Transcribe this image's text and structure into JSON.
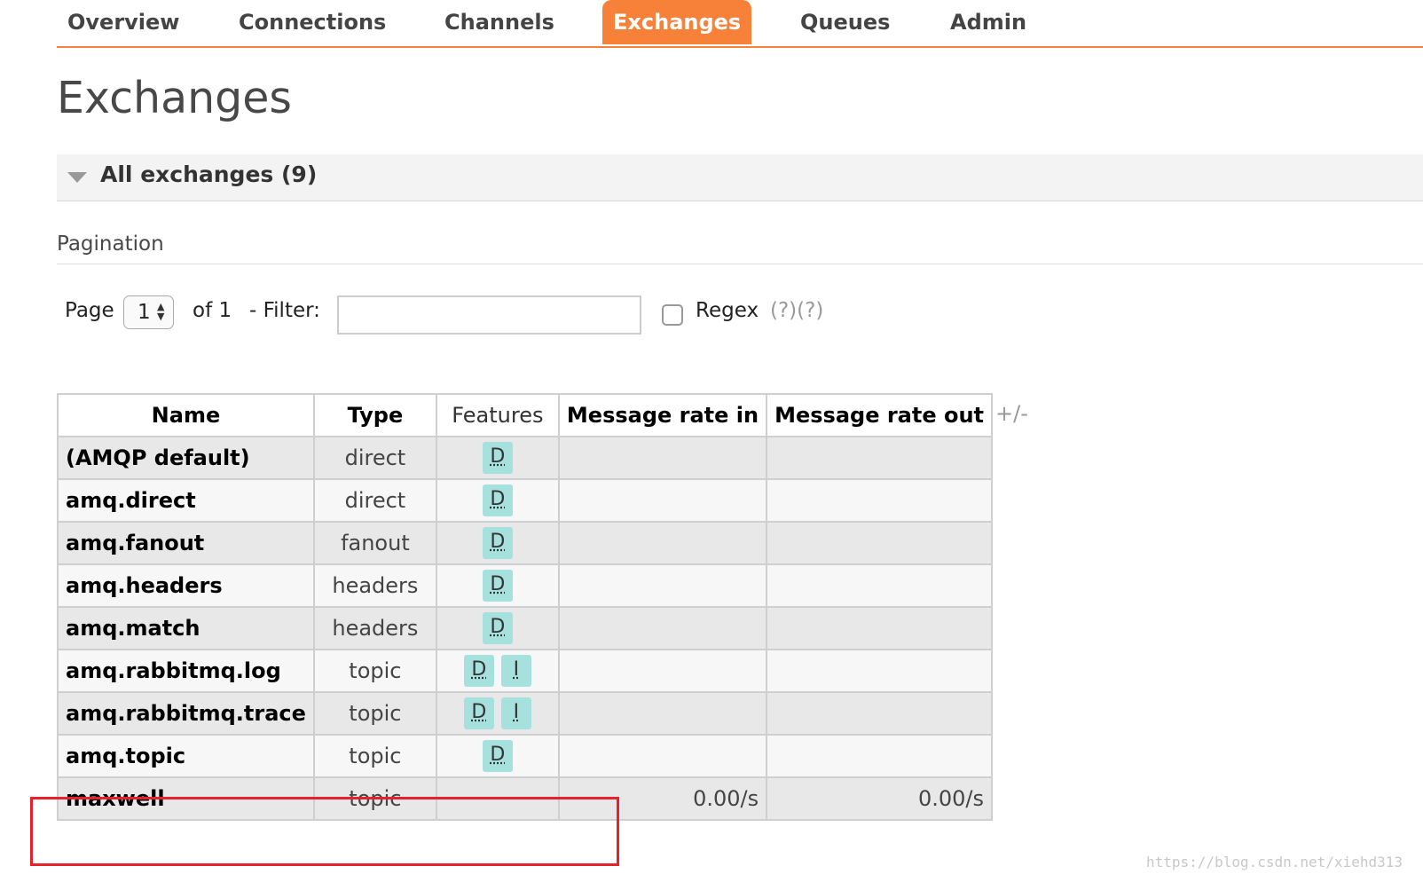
{
  "nav": {
    "tabs": [
      {
        "label": "Overview"
      },
      {
        "label": "Connections"
      },
      {
        "label": "Channels"
      },
      {
        "label": "Exchanges",
        "active": true
      },
      {
        "label": "Queues"
      },
      {
        "label": "Admin"
      }
    ],
    "accent": "#f8813a"
  },
  "page_title": "Exchanges",
  "section": {
    "title": "All exchanges (9)"
  },
  "pagination": {
    "label": "Pagination",
    "page_label": "Page",
    "page_value": "1",
    "of_label": "of 1",
    "filter_label": "- Filter:",
    "filter_value": "",
    "regex_label": "Regex",
    "regex_help": "(?)(?)",
    "regex_checked": false
  },
  "table": {
    "columns": [
      "Name",
      "Type",
      "Features",
      "Message rate in",
      "Message rate out"
    ],
    "toggle_columns": "+/-",
    "rows": [
      {
        "name": "(AMQP default)",
        "type": "direct",
        "features": [
          "D"
        ],
        "rate_in": "",
        "rate_out": ""
      },
      {
        "name": "amq.direct",
        "type": "direct",
        "features": [
          "D"
        ],
        "rate_in": "",
        "rate_out": ""
      },
      {
        "name": "amq.fanout",
        "type": "fanout",
        "features": [
          "D"
        ],
        "rate_in": "",
        "rate_out": ""
      },
      {
        "name": "amq.headers",
        "type": "headers",
        "features": [
          "D"
        ],
        "rate_in": "",
        "rate_out": ""
      },
      {
        "name": "amq.match",
        "type": "headers",
        "features": [
          "D"
        ],
        "rate_in": "",
        "rate_out": ""
      },
      {
        "name": "amq.rabbitmq.log",
        "type": "topic",
        "features": [
          "D",
          "I"
        ],
        "rate_in": "",
        "rate_out": ""
      },
      {
        "name": "amq.rabbitmq.trace",
        "type": "topic",
        "features": [
          "D",
          "I"
        ],
        "rate_in": "",
        "rate_out": ""
      },
      {
        "name": "amq.topic",
        "type": "topic",
        "features": [
          "D"
        ],
        "rate_in": "",
        "rate_out": ""
      },
      {
        "name": "maxwell",
        "type": "topic",
        "features": [],
        "rate_in": "0.00/s",
        "rate_out": "0.00/s"
      }
    ]
  },
  "highlight_color": "#e8202a",
  "watermark": "https://blog.csdn.net/xiehd313"
}
